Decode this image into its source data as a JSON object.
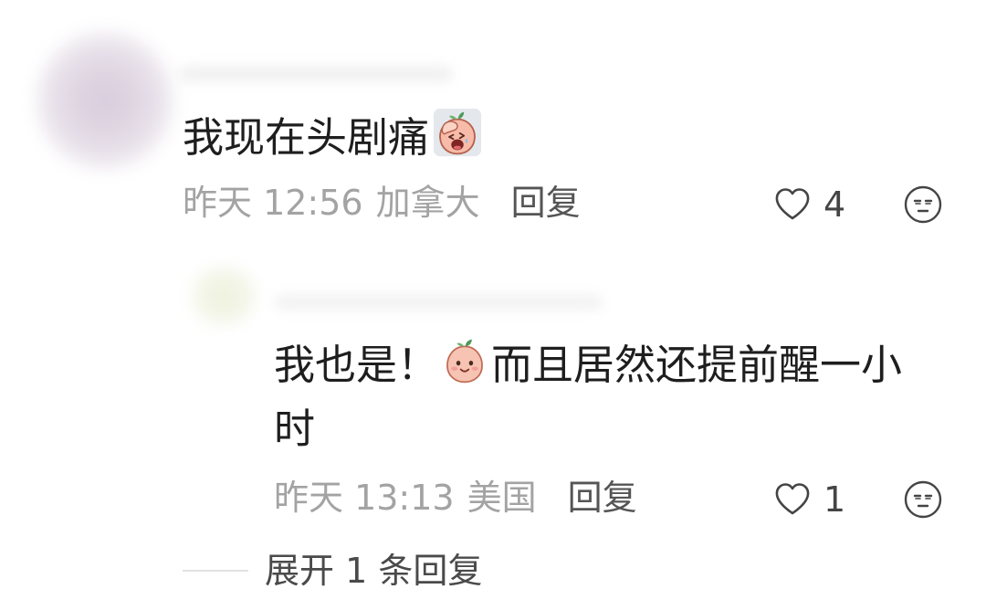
{
  "colors": {
    "text": "#1e1e1e",
    "meta": "#a3a3a3",
    "action": "#555555",
    "icon": "#444444",
    "divider": "#e3e3e3"
  },
  "comment": {
    "avatar_icon": "user-avatar",
    "text": "我现在头剧痛",
    "emoji_icon": "headache-emoji",
    "time": "昨天 12:56",
    "location": "加拿大",
    "reply_label": "回复",
    "like_icon": "heart-outline-icon",
    "like_count": "4",
    "reaction_icon": "emoji-face-icon"
  },
  "reply": {
    "avatar_icon": "user-avatar",
    "text_before_emoji": "我也是！",
    "emoji_icon": "smiling-peach-emoji",
    "text_after_emoji": "而且居然还提前醒一小时",
    "time": "昨天 13:13",
    "location": "美国",
    "reply_label": "回复",
    "like_icon": "heart-outline-icon",
    "like_count": "1",
    "reaction_icon": "emoji-face-icon"
  },
  "expand_replies": {
    "label": "展开 1 条回复"
  }
}
